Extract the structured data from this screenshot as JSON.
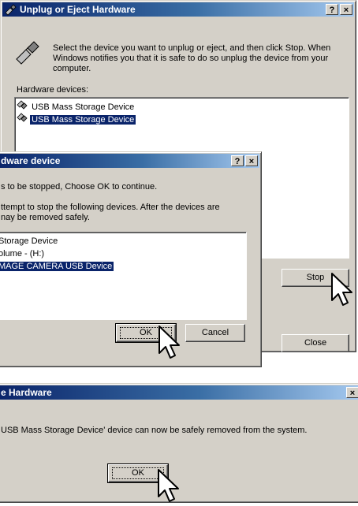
{
  "main_dialog": {
    "title": "Unplug or Eject Hardware",
    "help_label": "?",
    "close_label": "×",
    "instructions": [
      "Select the device you want to unplug or eject, and then click Stop. When",
      "Windows notifies you that it is safe to do so unplug the device from your",
      "computer."
    ],
    "list_label": "Hardware devices:",
    "devices": [
      "USB Mass Storage Device",
      "USB Mass Storage Device"
    ],
    "selected_index": 1,
    "stop_label": "Stop",
    "close_button_label": "Close"
  },
  "stop_dialog": {
    "title": "dware device",
    "help_label": "?",
    "close_label": "×",
    "line1": "s to be stopped, Choose OK to continue.",
    "line2a": "ttempt to stop the following devices. After the devices are",
    "line2b": "nay be removed safely.",
    "items": [
      "Storage Device",
      "olume - (H:)",
      "MAGE CAMERA USB Device"
    ],
    "selected_index": 2,
    "ok_label": "OK",
    "cancel_label": "Cancel"
  },
  "safe_dialog": {
    "title": "e Hardware",
    "close_label": "×",
    "message": "USB Mass Storage Device' device can now be safely removed from the system.",
    "ok_label": "OK"
  },
  "icons": {
    "main_title": "usb-plug-icon",
    "main_body": "unplug-hardware-icon",
    "device": "usb-device-icon",
    "cursor": "arrow-cursor-icon"
  }
}
